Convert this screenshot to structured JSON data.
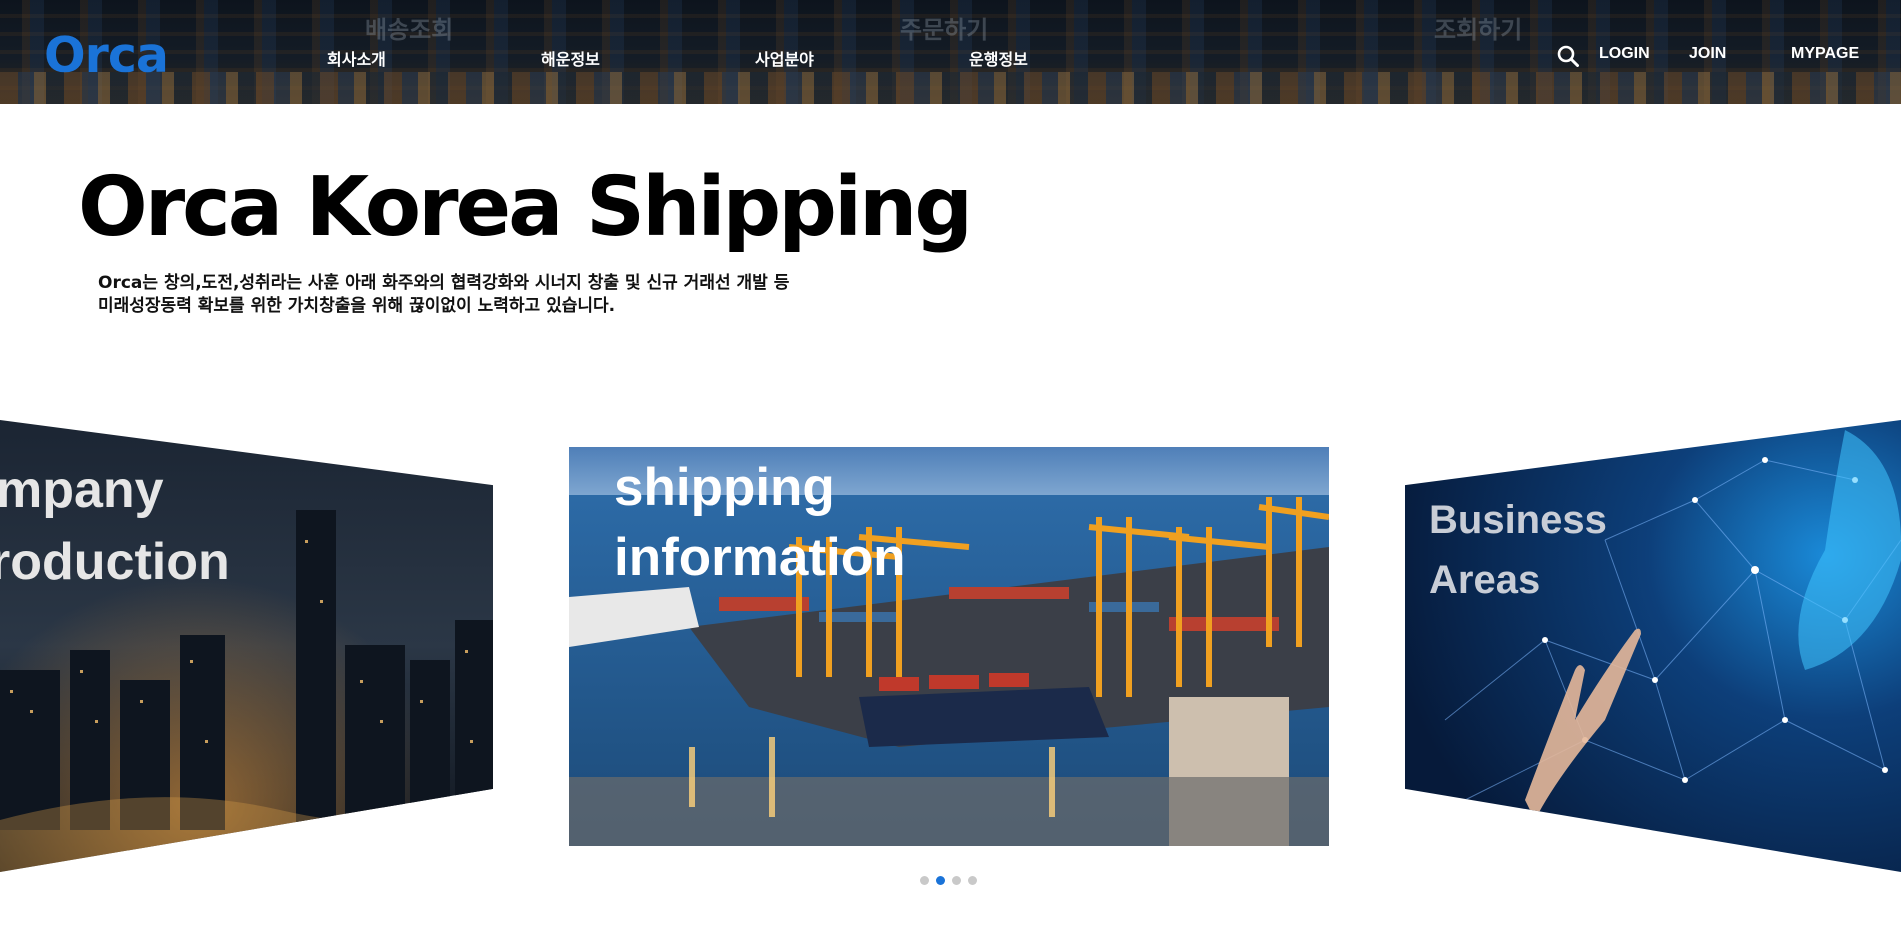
{
  "header": {
    "logo": "Orca",
    "ghost_labels": [
      "배송조회",
      "주문하기",
      "조회하기"
    ],
    "nav": [
      "회사소개",
      "해운정보",
      "사업분야",
      "운행정보"
    ],
    "search_icon": "search-icon",
    "login": "LOGIN",
    "join": "JOIN",
    "mypage": "MYPAGE"
  },
  "hero": {
    "title": "Orca Korea Shipping",
    "desc_line1": "Orca는 창의,도전,성취라는 사훈 아래 화주와의 협력강화와 시너지 창출 및 신규 거래선 개발 등",
    "desc_line2": "미래성장동력 확보를 위한 가치창출을 위해 끊이없이 노력하고 있습니다."
  },
  "slides": {
    "left": {
      "line1": "mpany",
      "line2": "roduction"
    },
    "center": {
      "line1": "shipping",
      "line2": "information"
    },
    "right": {
      "line1": "Business",
      "line2": "Areas"
    },
    "dot_count": 4,
    "active_index": 1
  },
  "colors": {
    "brand": "#1a73d8",
    "dot_inactive": "#c9c9c9"
  }
}
